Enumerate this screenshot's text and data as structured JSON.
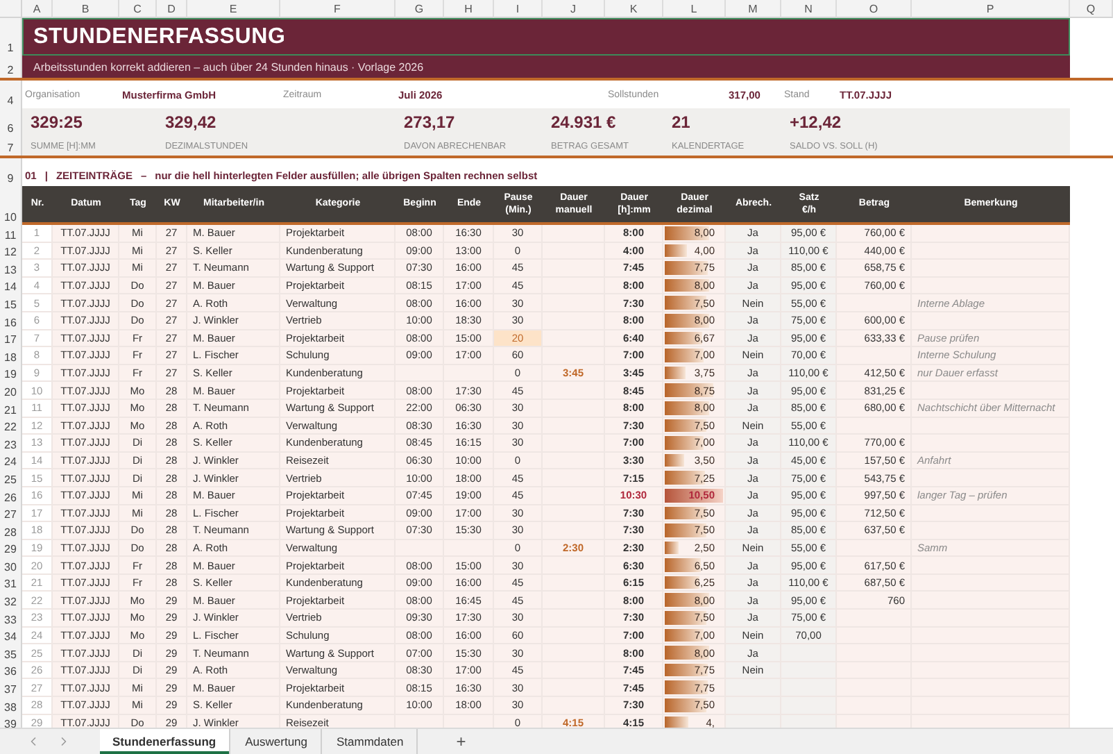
{
  "column_letters": [
    "A",
    "B",
    "C",
    "D",
    "E",
    "F",
    "G",
    "H",
    "I",
    "J",
    "K",
    "L",
    "M",
    "N",
    "O",
    "P",
    "Q"
  ],
  "title": "STUNDENERFASSUNG",
  "subtitle": "Arbeitsstunden korrekt addieren – auch über 24 Stunden hinaus  ·  Vorlage 2026",
  "top_row_numbers": [
    "1",
    "2",
    "4",
    "6",
    "7",
    "9",
    "10"
  ],
  "info": [
    {
      "label": "Organisation",
      "value": "Musterfirma GmbH"
    },
    {
      "label": "Zeitraum",
      "value": "Juli 2026"
    },
    {
      "label": "Sollstunden",
      "value": "317,00"
    },
    {
      "label": "Stand",
      "value": "TT.07.JJJJ"
    }
  ],
  "kpis": [
    {
      "value": "329:25",
      "label": "SUMME [H]:MM"
    },
    {
      "value": "329,42",
      "label": "DEZIMALSTUNDEN"
    },
    {
      "value": "273,17",
      "label": "DAVON ABRECHENBAR"
    },
    {
      "value": "24.931 €",
      "label": "BETRAG GESAMT"
    },
    {
      "value": "21",
      "label": "KALENDERTAGE"
    },
    {
      "value": "+12,42",
      "label": "SALDO VS. SOLL (H)"
    }
  ],
  "section": {
    "number": "01",
    "separator": "|",
    "title": "ZEITEINTRÄGE",
    "dash": "–",
    "note": "nur die hell hinterlegten Felder ausfüllen; alle übrigen Spalten rechnen selbst"
  },
  "columns": [
    "Nr.",
    "Datum",
    "Tag",
    "KW",
    "Mitarbeiter/in",
    "Kategorie",
    "Beginn",
    "Ende",
    "Pause\n(Min.)",
    "Dauer\nmanuell",
    "Dauer\n[h]:mm",
    "Dauer\ndezimal",
    "Abrech.",
    "Satz\n€/h",
    "Betrag",
    "Bemerkung"
  ],
  "rows": [
    {
      "row": "11",
      "nr": "1",
      "datum": "TT.07.JJJJ",
      "tag": "Mi",
      "kw": "27",
      "name": "M. Bauer",
      "kategorie": "Projektarbeit",
      "beginn": "08:00",
      "ende": "16:30",
      "pause": "30",
      "hhmm": "8:00",
      "dezimal": "8,00",
      "level": 0.76,
      "abrech": "Ja",
      "satz": "95,00 €",
      "betrag": "760,00 €",
      "pause_warning": false,
      "long_day": false
    },
    {
      "row": "12",
      "nr": "2",
      "datum": "TT.07.JJJJ",
      "tag": "Mi",
      "kw": "27",
      "name": "S. Keller",
      "kategorie": "Kundenberatung",
      "beginn": "09:00",
      "ende": "13:00",
      "pause": "0",
      "hhmm": "4:00",
      "dezimal": "4,00",
      "level": 0.38,
      "abrech": "Ja",
      "satz": "110,00 €",
      "betrag": "440,00 €",
      "pause_warning": false,
      "long_day": false
    },
    {
      "row": "13",
      "nr": "3",
      "datum": "TT.07.JJJJ",
      "tag": "Mi",
      "kw": "27",
      "name": "T. Neumann",
      "kategorie": "Wartung & Support",
      "beginn": "07:30",
      "ende": "16:00",
      "pause": "45",
      "hhmm": "7:45",
      "dezimal": "7,75",
      "level": 0.74,
      "abrech": "Ja",
      "satz": "85,00 €",
      "betrag": "658,75 €",
      "pause_warning": false,
      "long_day": false
    },
    {
      "row": "14",
      "nr": "4",
      "datum": "TT.07.JJJJ",
      "tag": "Do",
      "kw": "27",
      "name": "M. Bauer",
      "kategorie": "Projektarbeit",
      "beginn": "08:15",
      "ende": "17:00",
      "pause": "45",
      "hhmm": "8:00",
      "dezimal": "8,00",
      "level": 0.76,
      "abrech": "Ja",
      "satz": "95,00 €",
      "betrag": "760,00 €",
      "pause_warning": false,
      "long_day": false
    },
    {
      "row": "15",
      "nr": "5",
      "datum": "TT.07.JJJJ",
      "tag": "Do",
      "kw": "27",
      "name": "A. Roth",
      "kategorie": "Verwaltung",
      "beginn": "08:00",
      "ende": "16:00",
      "pause": "30",
      "hhmm": "7:30",
      "dezimal": "7,50",
      "level": 0.71,
      "abrech": "Nein",
      "satz": "55,00 €",
      "bemerkung": "Interne Ablage",
      "pause_warning": false,
      "long_day": false
    },
    {
      "row": "16",
      "nr": "6",
      "datum": "TT.07.JJJJ",
      "tag": "Do",
      "kw": "27",
      "name": "J. Winkler",
      "kategorie": "Vertrieb",
      "beginn": "10:00",
      "ende": "18:30",
      "pause": "30",
      "hhmm": "8:00",
      "dezimal": "8,00",
      "level": 0.76,
      "abrech": "Ja",
      "satz": "75,00 €",
      "betrag": "600,00 €",
      "pause_warning": false,
      "long_day": false
    },
    {
      "row": "17",
      "nr": "7",
      "datum": "TT.07.JJJJ",
      "tag": "Fr",
      "kw": "27",
      "name": "M. Bauer",
      "kategorie": "Projektarbeit",
      "beginn": "08:00",
      "ende": "15:00",
      "pause": "20",
      "hhmm": "6:40",
      "dezimal": "6,67",
      "level": 0.64,
      "abrech": "Ja",
      "satz": "95,00 €",
      "betrag": "633,33 €",
      "bemerkung": "Pause prüfen",
      "pause_warning": true,
      "long_day": false
    },
    {
      "row": "18",
      "nr": "8",
      "datum": "TT.07.JJJJ",
      "tag": "Fr",
      "kw": "27",
      "name": "L. Fischer",
      "kategorie": "Schulung",
      "beginn": "09:00",
      "ende": "17:00",
      "pause": "60",
      "hhmm": "7:00",
      "dezimal": "7,00",
      "level": 0.67,
      "abrech": "Nein",
      "satz": "70,00 €",
      "bemerkung": "Interne Schulung",
      "pause_warning": false,
      "long_day": false
    },
    {
      "row": "19",
      "nr": "9",
      "datum": "TT.07.JJJJ",
      "tag": "Fr",
      "kw": "27",
      "name": "S. Keller",
      "kategorie": "Kundenberatung",
      "pause": "0",
      "manuell": "3:45",
      "hhmm": "3:45",
      "dezimal": "3,75",
      "level": 0.36,
      "abrech": "Ja",
      "satz": "110,00 €",
      "betrag": "412,50 €",
      "bemerkung": "nur Dauer erfasst",
      "pause_warning": false,
      "long_day": false
    },
    {
      "row": "20",
      "nr": "10",
      "datum": "TT.07.JJJJ",
      "tag": "Mo",
      "kw": "28",
      "name": "M. Bauer",
      "kategorie": "Projektarbeit",
      "beginn": "08:00",
      "ende": "17:30",
      "pause": "45",
      "hhmm": "8:45",
      "dezimal": "8,75",
      "level": 0.83,
      "abrech": "Ja",
      "satz": "95,00 €",
      "betrag": "831,25 €",
      "pause_warning": false,
      "long_day": false
    },
    {
      "row": "21",
      "nr": "11",
      "datum": "TT.07.JJJJ",
      "tag": "Mo",
      "kw": "28",
      "name": "T. Neumann",
      "kategorie": "Wartung & Support",
      "beginn": "22:00",
      "ende": "06:30",
      "pause": "30",
      "hhmm": "8:00",
      "dezimal": "8,00",
      "level": 0.76,
      "abrech": "Ja",
      "satz": "85,00 €",
      "betrag": "680,00 €",
      "bemerkung": "Nachtschicht über Mitternacht",
      "pause_warning": false,
      "long_day": false
    },
    {
      "row": "22",
      "nr": "12",
      "datum": "TT.07.JJJJ",
      "tag": "Mo",
      "kw": "28",
      "name": "A. Roth",
      "kategorie": "Verwaltung",
      "beginn": "08:30",
      "ende": "16:30",
      "pause": "30",
      "hhmm": "7:30",
      "dezimal": "7,50",
      "level": 0.71,
      "abrech": "Nein",
      "satz": "55,00 €",
      "pause_warning": false,
      "long_day": false
    },
    {
      "row": "23",
      "nr": "13",
      "datum": "TT.07.JJJJ",
      "tag": "Di",
      "kw": "28",
      "name": "S. Keller",
      "kategorie": "Kundenberatung",
      "beginn": "08:45",
      "ende": "16:15",
      "pause": "30",
      "hhmm": "7:00",
      "dezimal": "7,00",
      "level": 0.67,
      "abrech": "Ja",
      "satz": "110,00 €",
      "betrag": "770,00 €",
      "pause_warning": false,
      "long_day": false
    },
    {
      "row": "24",
      "nr": "14",
      "datum": "TT.07.JJJJ",
      "tag": "Di",
      "kw": "28",
      "name": "J. Winkler",
      "kategorie": "Reisezeit",
      "beginn": "06:30",
      "ende": "10:00",
      "pause": "0",
      "hhmm": "3:30",
      "dezimal": "3,50",
      "level": 0.33,
      "abrech": "Ja",
      "satz": "45,00 €",
      "betrag": "157,50 €",
      "bemerkung": "Anfahrt",
      "pause_warning": false,
      "long_day": false
    },
    {
      "row": "25",
      "nr": "15",
      "datum": "TT.07.JJJJ",
      "tag": "Di",
      "kw": "28",
      "name": "J. Winkler",
      "kategorie": "Vertrieb",
      "beginn": "10:00",
      "ende": "18:00",
      "pause": "45",
      "hhmm": "7:15",
      "dezimal": "7,25",
      "level": 0.69,
      "abrech": "Ja",
      "satz": "75,00 €",
      "betrag": "543,75 €",
      "pause_warning": false,
      "long_day": false
    },
    {
      "row": "26",
      "nr": "16",
      "datum": "TT.07.JJJJ",
      "tag": "Mi",
      "kw": "28",
      "name": "M. Bauer",
      "kategorie": "Projektarbeit",
      "beginn": "07:45",
      "ende": "19:00",
      "pause": "45",
      "hhmm": "10:30",
      "dezimal": "10,50",
      "level": 1,
      "abrech": "Ja",
      "satz": "95,00 €",
      "betrag": "997,50 €",
      "bemerkung": "langer Tag – prüfen",
      "pause_warning": false,
      "long_day": true
    },
    {
      "row": "27",
      "nr": "17",
      "datum": "TT.07.JJJJ",
      "tag": "Mi",
      "kw": "28",
      "name": "L. Fischer",
      "kategorie": "Projektarbeit",
      "beginn": "09:00",
      "ende": "17:00",
      "pause": "30",
      "hhmm": "7:30",
      "dezimal": "7,50",
      "level": 0.71,
      "abrech": "Ja",
      "satz": "95,00 €",
      "betrag": "712,50 €",
      "pause_warning": false,
      "long_day": false
    },
    {
      "row": "28",
      "nr": "18",
      "datum": "TT.07.JJJJ",
      "tag": "Do",
      "kw": "28",
      "name": "T. Neumann",
      "kategorie": "Wartung & Support",
      "beginn": "07:30",
      "ende": "15:30",
      "pause": "30",
      "hhmm": "7:30",
      "dezimal": "7,50",
      "level": 0.71,
      "abrech": "Ja",
      "satz": "85,00 €",
      "betrag": "637,50 €",
      "pause_warning": false,
      "long_day": false
    },
    {
      "row": "29",
      "nr": "19",
      "datum": "TT.07.JJJJ",
      "tag": "Do",
      "kw": "28",
      "name": "A. Roth",
      "kategorie": "Verwaltung",
      "pause": "0",
      "manuell": "2:30",
      "hhmm": "2:30",
      "dezimal": "2,50",
      "level": 0.24,
      "abrech": "Nein",
      "satz": "55,00 €",
      "bemerkung": "Samm",
      "pause_warning": false,
      "long_day": false
    },
    {
      "row": "30",
      "nr": "20",
      "datum": "TT.07.JJJJ",
      "tag": "Fr",
      "kw": "28",
      "name": "M. Bauer",
      "kategorie": "Projektarbeit",
      "beginn": "08:00",
      "ende": "15:00",
      "pause": "30",
      "hhmm": "6:30",
      "dezimal": "6,50",
      "level": 0.62,
      "abrech": "Ja",
      "satz": "95,00 €",
      "betrag": "617,50 €",
      "pause_warning": false,
      "long_day": false
    },
    {
      "row": "31",
      "nr": "21",
      "datum": "TT.07.JJJJ",
      "tag": "Fr",
      "kw": "28",
      "name": "S. Keller",
      "kategorie": "Kundenberatung",
      "beginn": "09:00",
      "ende": "16:00",
      "pause": "45",
      "hhmm": "6:15",
      "dezimal": "6,25",
      "level": 0.6,
      "abrech": "Ja",
      "satz": "110,00 €",
      "betrag": "687,50 €",
      "pause_warning": false,
      "long_day": false
    },
    {
      "row": "32",
      "nr": "22",
      "datum": "TT.07.JJJJ",
      "tag": "Mo",
      "kw": "29",
      "name": "M. Bauer",
      "kategorie": "Projektarbeit",
      "beginn": "08:00",
      "ende": "16:45",
      "pause": "45",
      "hhmm": "8:00",
      "dezimal": "8,00",
      "level": 0.76,
      "abrech": "Ja",
      "satz": "95,00 €",
      "betrag": "760",
      "pause_warning": false,
      "long_day": false
    },
    {
      "row": "33",
      "nr": "23",
      "datum": "TT.07.JJJJ",
      "tag": "Mo",
      "kw": "29",
      "name": "J. Winkler",
      "kategorie": "Vertrieb",
      "beginn": "09:30",
      "ende": "17:30",
      "pause": "30",
      "hhmm": "7:30",
      "dezimal": "7,50",
      "level": 0.71,
      "abrech": "Ja",
      "satz": "75,00 €",
      "pause_warning": false,
      "long_day": false
    },
    {
      "row": "34",
      "nr": "24",
      "datum": "TT.07.JJJJ",
      "tag": "Mo",
      "kw": "29",
      "name": "L. Fischer",
      "kategorie": "Schulung",
      "beginn": "08:00",
      "ende": "16:00",
      "pause": "60",
      "hhmm": "7:00",
      "dezimal": "7,00",
      "level": 0.67,
      "abrech": "Nein",
      "satz": "70,00",
      "pause_warning": false,
      "long_day": false
    },
    {
      "row": "35",
      "nr": "25",
      "datum": "TT.07.JJJJ",
      "tag": "Di",
      "kw": "29",
      "name": "T. Neumann",
      "kategorie": "Wartung & Support",
      "beginn": "07:00",
      "ende": "15:30",
      "pause": "30",
      "hhmm": "8:00",
      "dezimal": "8,00",
      "level": 0.76,
      "abrech": "Ja",
      "pause_warning": false,
      "long_day": false
    },
    {
      "row": "36",
      "nr": "26",
      "datum": "TT.07.JJJJ",
      "tag": "Di",
      "kw": "29",
      "name": "A. Roth",
      "kategorie": "Verwaltung",
      "beginn": "08:30",
      "ende": "17:00",
      "pause": "45",
      "hhmm": "7:45",
      "dezimal": "7,75",
      "level": 0.74,
      "abrech": "Nein",
      "pause_warning": false,
      "long_day": false
    },
    {
      "row": "37",
      "nr": "27",
      "datum": "TT.07.JJJJ",
      "tag": "Mi",
      "kw": "29",
      "name": "M. Bauer",
      "kategorie": "Projektarbeit",
      "beginn": "08:15",
      "ende": "16:30",
      "pause": "30",
      "hhmm": "7:45",
      "dezimal": "7,75",
      "level": 0.74,
      "pause_warning": false,
      "long_day": false
    },
    {
      "row": "38",
      "nr": "28",
      "datum": "TT.07.JJJJ",
      "tag": "Mi",
      "kw": "29",
      "name": "S. Keller",
      "kategorie": "Kundenberatung",
      "beginn": "10:00",
      "ende": "18:00",
      "pause": "30",
      "hhmm": "7:30",
      "dezimal": "7,50",
      "level": 0.71,
      "pause_warning": false,
      "long_day": false
    },
    {
      "row": "39",
      "nr": "29",
      "datum": "TT.07.JJJJ",
      "tag": "Do",
      "kw": "29",
      "name": "J. Winkler",
      "kategorie": "Reisezeit",
      "pause": "0",
      "manuell": "4:15",
      "hhmm": "4:15",
      "dezimal": "4,",
      "level": 0.4,
      "pause_warning": false,
      "long_day": false
    }
  ],
  "sheet_tabs": [
    {
      "label": "Stundenerfassung",
      "selected": true
    },
    {
      "label": "Auswertung",
      "selected": false
    },
    {
      "label": "Stammdaten",
      "selected": false
    }
  ],
  "add_sheet": "+"
}
